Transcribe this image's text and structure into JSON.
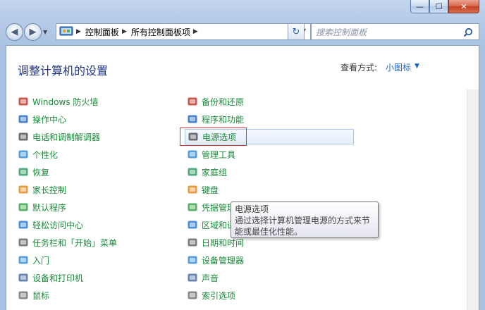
{
  "window": {
    "caption": {
      "min": "—",
      "max": "☐",
      "close": "✕"
    }
  },
  "address": {
    "crumbs": [
      "控制面板",
      "所有控制面板项"
    ]
  },
  "search": {
    "placeholder": "搜索控制面板"
  },
  "header": {
    "title": "调整计算机的设置",
    "view_by_label": "查看方式:",
    "view_by_value": "小图标"
  },
  "left_items": [
    {
      "label": "Windows 防火墙",
      "icon": "firewall-icon"
    },
    {
      "label": "操作中心",
      "icon": "action-center-flag-icon"
    },
    {
      "label": "电话和调制解调器",
      "icon": "phone-modem-icon"
    },
    {
      "label": "个性化",
      "icon": "personalization-icon"
    },
    {
      "label": "恢复",
      "icon": "recovery-icon"
    },
    {
      "label": "家长控制",
      "icon": "parental-controls-icon"
    },
    {
      "label": "默认程序",
      "icon": "default-programs-icon"
    },
    {
      "label": "轻松访问中心",
      "icon": "ease-of-access-icon"
    },
    {
      "label": "任务栏和「开始」菜单",
      "icon": "taskbar-icon"
    },
    {
      "label": "入门",
      "icon": "getting-started-icon"
    },
    {
      "label": "设备和打印机",
      "icon": "devices-printers-icon"
    },
    {
      "label": "鼠标",
      "icon": "mouse-icon"
    }
  ],
  "right_items": [
    {
      "label": "备份和还原",
      "icon": "backup-icon"
    },
    {
      "label": "程序和功能",
      "icon": "programs-features-icon"
    },
    {
      "label": "电源选项",
      "icon": "power-options-icon"
    },
    {
      "label": "管理工具",
      "icon": "admin-tools-icon"
    },
    {
      "label": "家庭组",
      "icon": "homegroup-icon"
    },
    {
      "label": "键盘",
      "icon": "keyboard-icon"
    },
    {
      "label": "凭据管理器",
      "icon": "credential-manager-icon"
    },
    {
      "label": "区域和语言",
      "icon": "region-language-icon"
    },
    {
      "label": "日期和时间",
      "icon": "date-time-icon"
    },
    {
      "label": "设备管理器",
      "icon": "device-manager-icon"
    },
    {
      "label": "声音",
      "icon": "sound-icon"
    },
    {
      "label": "索引选项",
      "icon": "indexing-icon"
    }
  ],
  "tooltip": {
    "title": "电源选项",
    "line1": "通过选择计算机管理电源的方式来节",
    "line2": "能或最佳化性能。"
  },
  "colors": {
    "link_green": "#1a8a3a",
    "title_blue": "#1e3287",
    "accent_blue": "#1e64c8",
    "highlight_red": "#e03030"
  }
}
